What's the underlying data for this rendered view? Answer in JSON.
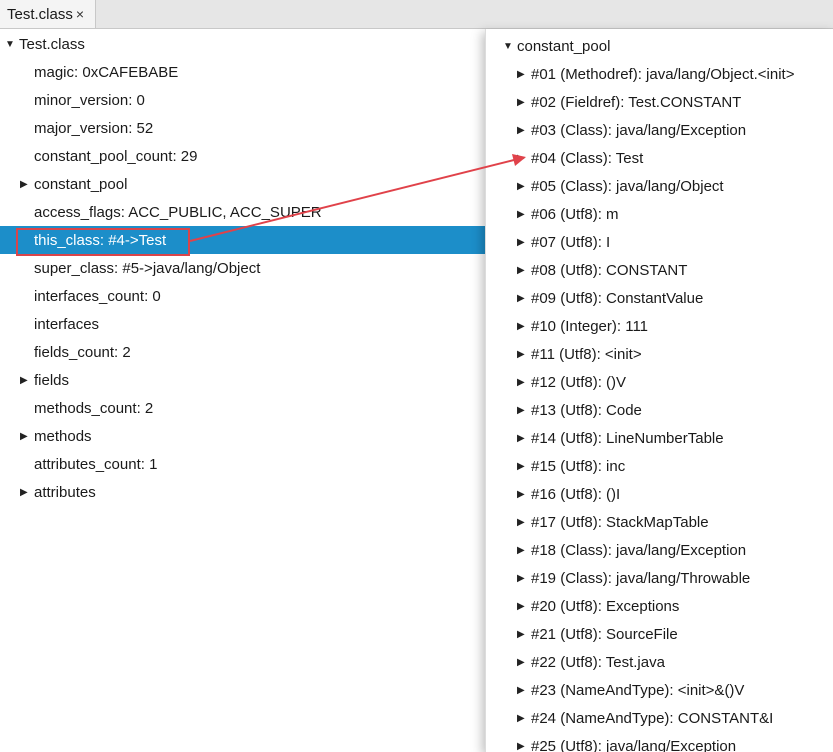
{
  "tab": {
    "title": "Test.class",
    "close": "×"
  },
  "tree": {
    "root": "Test.class",
    "items": [
      {
        "label": "magic: 0xCAFEBABE",
        "expandable": false
      },
      {
        "label": "minor_version: 0",
        "expandable": false
      },
      {
        "label": "major_version: 52",
        "expandable": false
      },
      {
        "label": "constant_pool_count: 29",
        "expandable": false
      },
      {
        "label": "constant_pool",
        "expandable": true
      },
      {
        "label": "access_flags: ACC_PUBLIC, ACC_SUPER",
        "expandable": false
      },
      {
        "label": "this_class: #4->Test",
        "expandable": false,
        "selected": true
      },
      {
        "label": "super_class: #5->java/lang/Object",
        "expandable": false
      },
      {
        "label": "interfaces_count: 0",
        "expandable": false
      },
      {
        "label": "interfaces",
        "expandable": false
      },
      {
        "label": "fields_count: 2",
        "expandable": false
      },
      {
        "label": "fields",
        "expandable": true
      },
      {
        "label": "methods_count: 2",
        "expandable": false
      },
      {
        "label": "methods",
        "expandable": true
      },
      {
        "label": "attributes_count: 1",
        "expandable": false
      },
      {
        "label": "attributes",
        "expandable": true
      }
    ]
  },
  "constant_pool": {
    "root": "constant_pool",
    "items": [
      "#01 (Methodref): java/lang/Object.<init>",
      "#02 (Fieldref): Test.CONSTANT",
      "#03 (Class): java/lang/Exception",
      "#04 (Class): Test",
      "#05 (Class): java/lang/Object",
      "#06 (Utf8): m",
      "#07 (Utf8): I",
      "#08 (Utf8): CONSTANT",
      "#09 (Utf8): ConstantValue",
      "#10 (Integer): 111",
      "#11 (Utf8): <init>",
      "#12 (Utf8): ()V",
      "#13 (Utf8): Code",
      "#14 (Utf8): LineNumberTable",
      "#15 (Utf8): inc",
      "#16 (Utf8): ()I",
      "#17 (Utf8): StackMapTable",
      "#18 (Class): java/lang/Exception",
      "#19 (Class): java/lang/Throwable",
      "#20 (Utf8): Exceptions",
      "#21 (Utf8): SourceFile",
      "#22 (Utf8): Test.java",
      "#23 (NameAndType): <init>&()V",
      "#24 (NameAndType): CONSTANT&I",
      "#25 (Utf8): java/lang/Exception"
    ]
  },
  "colors": {
    "selection": "#1c8ec9",
    "annotation": "#d9454a"
  },
  "icons": {
    "expanded": "triangle-down-icon",
    "collapsed": "triangle-right-icon"
  }
}
